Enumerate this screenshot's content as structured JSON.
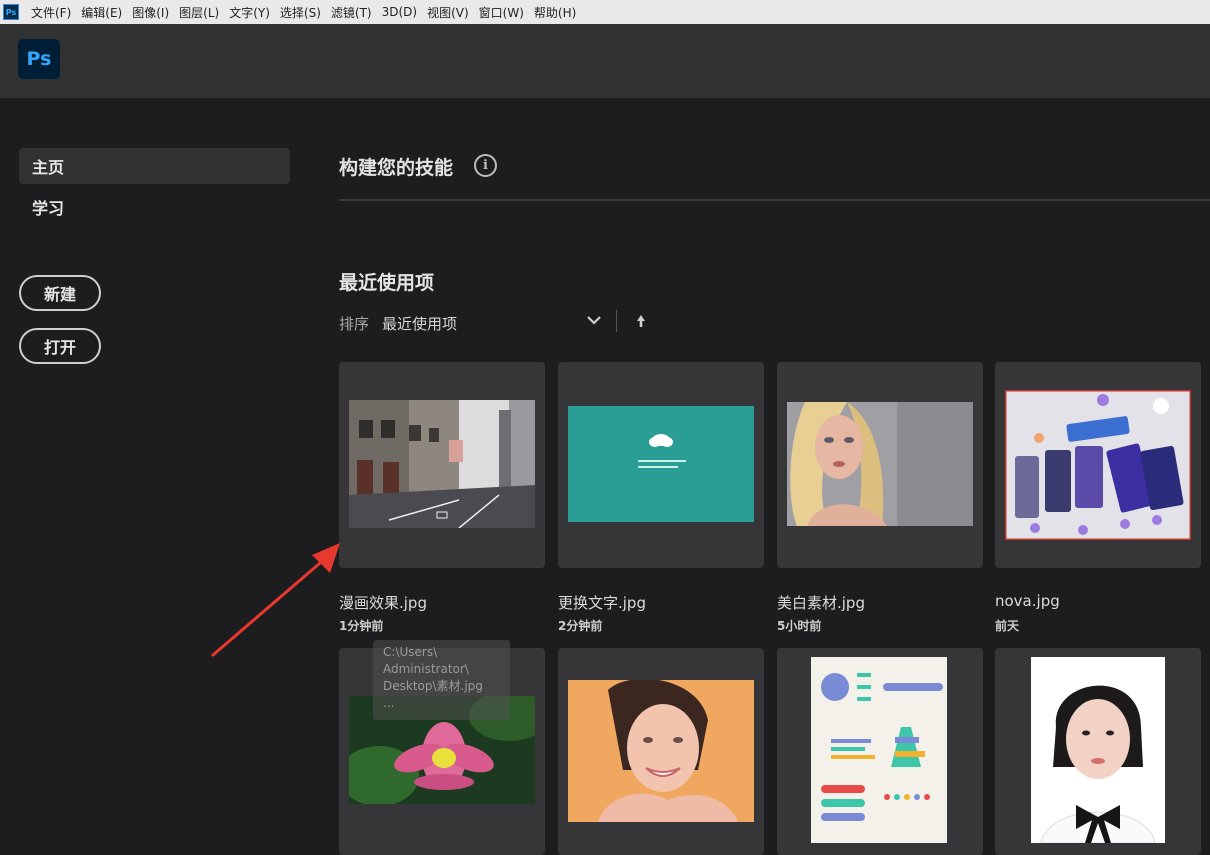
{
  "menubar": {
    "items": [
      "文件(F)",
      "编辑(E)",
      "图像(I)",
      "图层(L)",
      "文字(Y)",
      "选择(S)",
      "滤镜(T)",
      "3D(D)",
      "视图(V)",
      "窗口(W)",
      "帮助(H)"
    ]
  },
  "app": {
    "logo": "Ps",
    "menu_logo": "Ps"
  },
  "sidebar": {
    "items": [
      {
        "label": "主页",
        "active": true
      },
      {
        "label": "学习",
        "active": false
      }
    ],
    "new_button": "新建",
    "open_button": "打开"
  },
  "main": {
    "skills_title": "构建您的技能",
    "info_glyph": "i",
    "recent_title": "最近使用项",
    "sort_label": "排序",
    "sort_value": "最近使用项",
    "files": [
      {
        "name": "漫画效果.jpg",
        "time": "1分钟前"
      },
      {
        "name": "更换文字.jpg",
        "time": "2分钟前"
      },
      {
        "name": "美白素材.jpg",
        "time": "5小时前"
      },
      {
        "name": "nova.jpg",
        "time": "前天"
      }
    ],
    "tooltip": {
      "lines": [
        "C:\\Users\\",
        "Administrator\\",
        "Desktop\\素材.jpg",
        "..."
      ]
    }
  },
  "icons": {
    "info": "info-icon",
    "sort": "chevron-down-icon",
    "order": "arrow-up-icon",
    "pointer": "arrow-annotation"
  },
  "colors": {
    "accent": "#31a8ff",
    "annotation": "#e8392e",
    "teal": "#2a9d95"
  }
}
